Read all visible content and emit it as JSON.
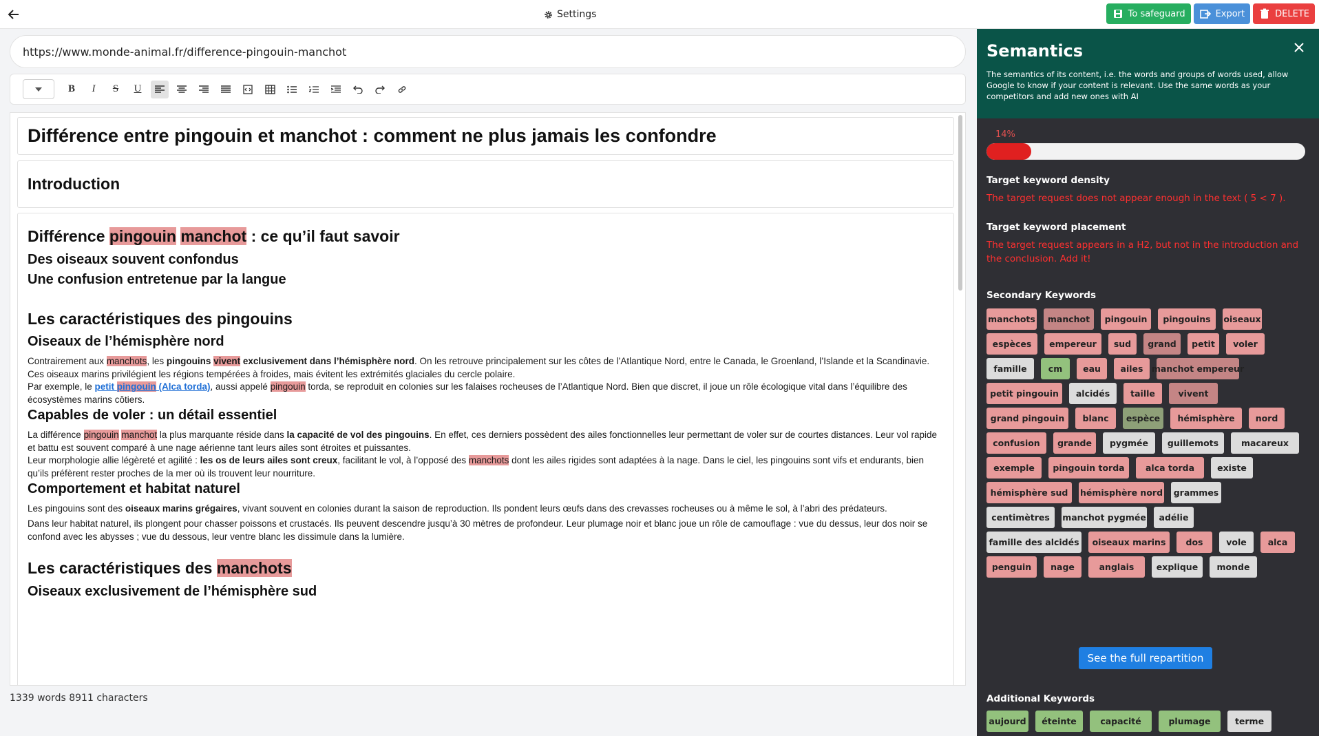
{
  "topbar": {
    "settings_label": "Settings",
    "save_label": "To safeguard",
    "export_label": "Export",
    "delete_label": "DELETE"
  },
  "editor": {
    "url": "https://www.monde-animal.fr/difference-pingouin-manchot",
    "title": "Différence entre pingouin et manchot : comment ne plus jamais les confondre",
    "intro_heading": "Introduction",
    "h2_diff": {
      "before": "Différence",
      "kw1": "pingouin",
      "sep": " ",
      "kw2": "manchot",
      "after": " : ce qu’il faut savoir"
    },
    "h3_confondus": "Des oiseaux souvent confondus",
    "h3_langue": "Une confusion entretenue par la langue",
    "h2_pingouins": "Les caractéristiques des pingouins",
    "h3_nord": "Oiseaux de l’hémisphère nord",
    "p1": {
      "a": "Contrairement aux ",
      "hl1": "manchots",
      "b": ", les ",
      "bold1": "pingouins ",
      "hl2": "vivent",
      "bold2": " exclusivement dans l’hémisphère nord",
      "c": ". On les retrouve principalement sur les côtes de l’Atlantique Nord, entre le Canada, le Groenland, l’Islande et la Scandinavie. Ces oiseaux marins privilégient les régions tempérées à froides, mais évitent les extrémités glaciales du cercle polaire."
    },
    "p2": {
      "a": "Par exemple, le ",
      "link_a": "petit ",
      "link_hl": "pingouin",
      "link_b": " (Alca torda)",
      "b": ", aussi appelé ",
      "hl": "pingouin",
      "c": " torda, se reproduit en colonies sur les falaises rocheuses de l’Atlantique Nord. Bien que discret, il joue un rôle écologique vital dans l’équilibre des écosystèmes marins côtiers."
    },
    "h3_voler": "Capables de voler : un détail essentiel",
    "p3": {
      "a": "La différence ",
      "hl1": "pingouin",
      "sep": " ",
      "hl2": "manchot",
      "b": " la plus marquante réside dans ",
      "bold": "la capacité de vol des pingouins",
      "c": ". En effet, ces derniers possèdent des ailes fonctionnelles leur permettant de voler sur de courtes distances. Leur vol rapide et battu est souvent comparé à une nage aérienne tant leurs ailes sont étroites et puissantes."
    },
    "p4": {
      "a": "Leur morphologie allie légèreté et agilité : ",
      "bold": "les os de leurs ailes sont creux",
      "b": ", facilitant le vol, à l’opposé des ",
      "hl": "manchots",
      "c": " dont les ailes rigides sont adaptées à la nage. Dans le ciel, les pingouins sont vifs et endurants, bien qu’ils préfèrent rester proches de la mer où ils trouvent leur nourriture."
    },
    "h3_habitat": "Comportement et habitat naturel",
    "p5": {
      "a": "Les pingouins sont des ",
      "bold": "oiseaux marins grégaires",
      "b": ", vivant souvent en colonies durant la saison de reproduction. Ils pondent leurs œufs dans des crevasses rocheuses ou à même le sol, à l’abri des prédateurs."
    },
    "p6": "Dans leur habitat naturel, ils plongent pour chasser poissons et crustacés. Ils peuvent descendre jusqu’à 30 mètres de profondeur. Leur plumage noir et blanc joue un rôle de camouflage : vue du dessus, leur dos noir se confond avec les abysses ; vue du dessous, leur ventre blanc les dissimule dans la lumière.",
    "h2_manchots": {
      "before": "Les caractéristiques des ",
      "kw": "manchots"
    },
    "h3_sud": "Oiseaux exclusivement de l’hémisphère sud",
    "word_count": "1339 words 8911 characters"
  },
  "panel": {
    "title": "Semantics",
    "description": "The semantics of its content, i.e. the words and groups of words used, allow Google to know if your content is relevant. Use the same words as your competitors and add new ones with AI",
    "progress_label": "14%",
    "progress_value": 0.14,
    "density_title": "Target keyword density",
    "density_warning": "The target request does not appear enough in the text ( 5 < 7 ).",
    "placement_title": "Target keyword placement",
    "placement_warning": "The target request appears in a H2, but not in the introduction and the conclusion. Add it!",
    "secondary_title": "Secondary Keywords",
    "secondary_keywords": [
      "manchots",
      "manchot",
      "pingouin",
      "pingouins",
      "oiseaux",
      "espèces",
      "empereur",
      "sud",
      "grand",
      "petit",
      "voler",
      "famille",
      "cm",
      "eau",
      "ailes",
      "manchot empereur",
      "petit pingouin",
      "alcidés",
      "taille",
      "vivent",
      "grand pingouin",
      "blanc",
      "espèce",
      "hémisphère",
      "nord",
      "confusion",
      "grande",
      "pygmée",
      "guillemots",
      "macareux",
      "exemple",
      "pingouin torda",
      "alca torda",
      "existe",
      "hémisphère sud",
      "hémisphère nord",
      "grammes",
      "centimètres",
      "manchot pygmée",
      "adélie",
      "famille des alcidés",
      "oiseaux marins",
      "dos",
      "vole",
      "alca",
      "penguin",
      "nage",
      "anglais",
      "explique",
      "monde"
    ],
    "see_button": "See the full repartition",
    "additional_title": "Additional Keywords",
    "additional_keywords": [
      "aujourd",
      "éteinte",
      "capacité",
      "plumage",
      "terme"
    ],
    "colors": {
      "header_bg": "#0a5448",
      "panel_bg": "#2f2f34",
      "warning": "#ff3030",
      "tag_strong": "#e79a9a",
      "tag_used": "#c48585",
      "tag_neutral": "#dcdcdc",
      "tag_good": "#93c17d"
    }
  }
}
